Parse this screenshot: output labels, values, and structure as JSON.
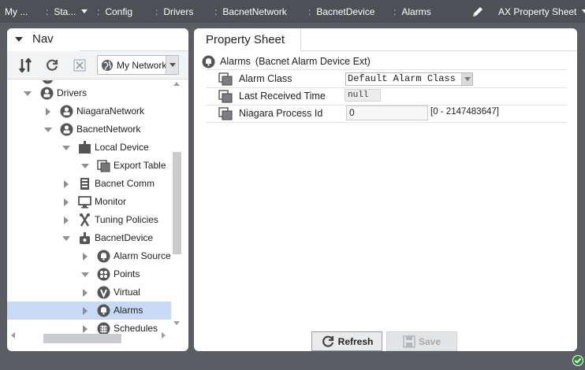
{
  "topbar": {
    "crumbs": [
      {
        "label": "My ...",
        "dots": false,
        "caret": false
      },
      {
        "label": "Sta...",
        "dots": true,
        "caret": true
      },
      {
        "label": "Config",
        "dots": true,
        "caret": false
      },
      {
        "label": "Drivers",
        "dots": true,
        "caret": false
      },
      {
        "label": "BacnetNetwork",
        "dots": true,
        "caret": false
      },
      {
        "label": "BacnetDevice",
        "dots": true,
        "caret": false
      },
      {
        "label": "Alarms",
        "dots": true,
        "caret": false
      }
    ],
    "view_label": "AX Property Sheet"
  },
  "nav": {
    "tab_label": "Nav",
    "network_select": "My Network",
    "tree": [
      {
        "label": "",
        "icon": "gear-icon",
        "expander": "none",
        "depth": 2,
        "partial": true
      },
      {
        "label": "Drivers",
        "icon": "driver-icon",
        "expander": "down",
        "depth": 1
      },
      {
        "label": "NiagaraNetwork",
        "icon": "network-icon",
        "expander": "right",
        "depth": 2
      },
      {
        "label": "BacnetNetwork",
        "icon": "network-icon",
        "expander": "down",
        "depth": 2
      },
      {
        "label": "Local Device",
        "icon": "device-icon",
        "expander": "down",
        "depth": 3
      },
      {
        "label": "Export Table",
        "icon": "folder-icon",
        "expander": "down",
        "depth": 4
      },
      {
        "label": "Bacnet Comm",
        "icon": "comm-icon",
        "expander": "right",
        "depth": 3
      },
      {
        "label": "Monitor",
        "icon": "monitor-icon",
        "expander": "right",
        "depth": 3
      },
      {
        "label": "Tuning Policies",
        "icon": "tuning-icon",
        "expander": "right",
        "depth": 3
      },
      {
        "label": "BacnetDevice",
        "icon": "device-icon",
        "expander": "down",
        "depth": 3
      },
      {
        "label": "Alarm Source I",
        "icon": "bell-icon",
        "expander": "right",
        "depth": 4
      },
      {
        "label": "Points",
        "icon": "points-icon",
        "expander": "down",
        "depth": 4
      },
      {
        "label": "Virtual",
        "icon": "virtual-icon",
        "expander": "right",
        "depth": 4
      },
      {
        "label": "Alarms",
        "icon": "bell-icon",
        "expander": "right",
        "depth": 4,
        "selected": true
      },
      {
        "label": "Schedules",
        "icon": "schedule-icon",
        "expander": "right",
        "depth": 4
      }
    ]
  },
  "sheet": {
    "tab_label": "Property Sheet",
    "object_name": "Alarms",
    "object_type": "(Bacnet Alarm Device Ext)",
    "props": {
      "alarm_class": {
        "label": "Alarm Class",
        "value": "Default Alarm Class"
      },
      "last_received": {
        "label": "Last Received Time",
        "value": "null"
      },
      "process_id": {
        "label": "Niagara Process Id",
        "value": "0",
        "range": "[0 - 2147483647]"
      }
    },
    "refresh_label": "Refresh",
    "save_label": "Save"
  }
}
